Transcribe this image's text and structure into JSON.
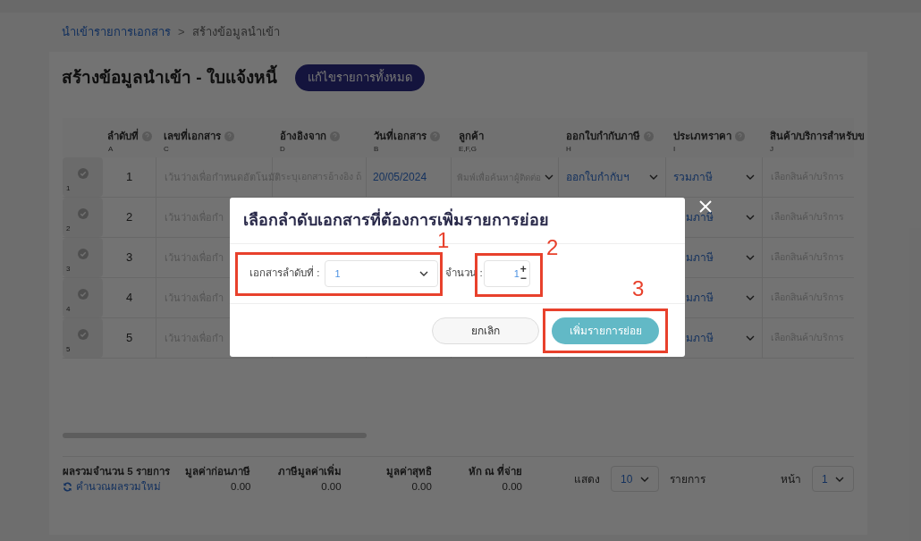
{
  "breadcrumb": [
    {
      "label": "นำเข้ารายการเอกสาร",
      "kind": "link"
    },
    {
      "label": "สร้างข้อมูลนำเข้า",
      "kind": "current"
    }
  ],
  "breadcrumb_separator": ">",
  "page_title": "สร้างข้อมูลนำเข้า - ใบแจ้งหนี้",
  "edit_all_button": "แก้ไขรายการทั้งหมด",
  "table": {
    "columns": [
      {
        "label": "ลำดับที่",
        "letter": "A",
        "help": true
      },
      {
        "label": "เลขที่เอกสาร",
        "letter": "C",
        "help": true
      },
      {
        "label": "อ้างอิงจาก",
        "letter": "D",
        "help": true
      },
      {
        "label": "วันที่เอกสาร",
        "letter": "B",
        "help": true
      },
      {
        "label": "ลูกค้า",
        "letter": "E,F,G",
        "help": false
      },
      {
        "label": "ออกใบกำกับภาษี",
        "letter": "H",
        "help": true
      },
      {
        "label": "ประเภทราคา",
        "letter": "I",
        "help": true
      },
      {
        "label": "สินค้า/บริการสำหรับข",
        "letter": "J"
      }
    ],
    "rows": [
      {
        "row_label": "1",
        "number": "1",
        "covered": false,
        "doc_no_placeholder": "เว้นว่างเพื่อกำหนดอัตโนมัติ",
        "ref_placeholder": "ระบุเอกสารอ้างอิง ถ้",
        "date": "20/05/2024",
        "customer_placeholder": "พิมพ์เพื่อค้นหาผู้ติดต่อ",
        "tax_invoice": "ออกใบกำกับฯ",
        "price_type": "รวมภาษี",
        "product_placeholder": "เลือกสินค้า/บริการ"
      },
      {
        "row_label": "2",
        "number": "2",
        "covered": true,
        "doc_no_placeholder": "เว้นว่างเพื่อกำ",
        "price_type": "มภาษี",
        "product_placeholder": "เลือกสินค้า/บริการ"
      },
      {
        "row_label": "3",
        "number": "3",
        "covered": true,
        "doc_no_placeholder": "เว้นว่างเพื่อกำ",
        "price_type": "มภาษี",
        "product_placeholder": "เลือกสินค้า/บริการ"
      },
      {
        "row_label": "4",
        "number": "4",
        "covered": true,
        "doc_no_placeholder": "เว้นว่างเพื่อกำ",
        "price_type": "มภาษี",
        "product_placeholder": "เลือกสินค้า/บริการ"
      },
      {
        "row_label": "5",
        "number": "5",
        "covered": true,
        "doc_no_placeholder": "เว้นว่างเพื่อกำ",
        "price_type": "มภาษี",
        "product_placeholder": "เลือกสินค้า/บริการ"
      }
    ]
  },
  "footer": {
    "summary": "ผลรวมจำนวน 5 รายการ",
    "recalculate_link": "คำนวณผลรวมใหม่",
    "totals": [
      {
        "label": "มูลค่าก่อนภาษี",
        "value": "0.00"
      },
      {
        "label": "ภาษีมูลค่าเพิ่ม",
        "value": "0.00"
      },
      {
        "label": "มูลค่าสุทธิ",
        "value": "0.00"
      },
      {
        "label": "หัก ณ ที่จ่าย",
        "value": "0.00"
      }
    ],
    "show_label": "แสดง",
    "page_size": "10",
    "items_label": "รายการ",
    "page_label": "หน้า",
    "page": "1"
  },
  "dialog": {
    "title": "เลือกลำดับเอกสารที่ต้องการเพิ่มรายการย่อย",
    "document_label": "เอกสารลำดับที่ :",
    "document_value": "1",
    "quantity_label": "จำนวน :",
    "quantity_value": "1",
    "increment": "+",
    "decrement": "−",
    "cancel_button": "ยกเลิก",
    "confirm_button": "เพิ่มรายการย่อย"
  },
  "annotations": [
    {
      "label": "1"
    },
    {
      "label": "2"
    },
    {
      "label": "3"
    }
  ]
}
